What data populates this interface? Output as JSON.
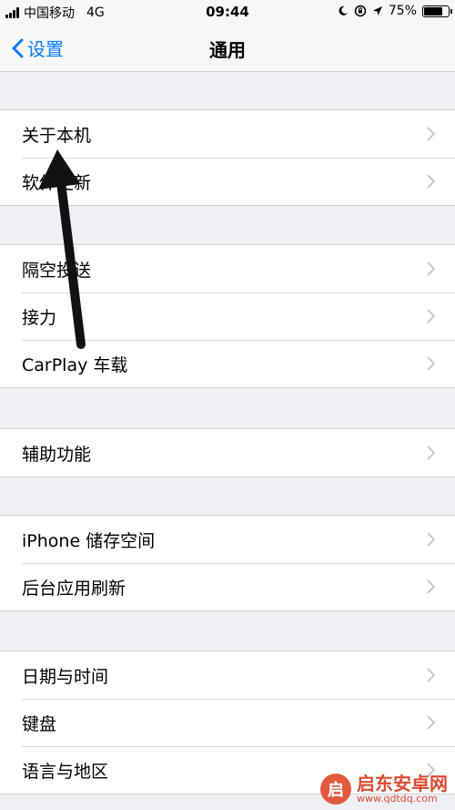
{
  "status_bar": {
    "carrier": "中国移动",
    "network": "4G",
    "time": "09:44",
    "battery": "75%",
    "battery_level": 0.75
  },
  "nav": {
    "back_label": "设置",
    "title": "通用"
  },
  "groups": [
    {
      "items": [
        "关于本机",
        "软件更新"
      ]
    },
    {
      "items": [
        "隔空投送",
        "接力",
        "CarPlay 车载"
      ]
    },
    {
      "items": [
        "辅助功能"
      ]
    },
    {
      "items": [
        "iPhone 储存空间",
        "后台应用刷新"
      ]
    },
    {
      "items": [
        "日期与时间",
        "键盘",
        "语言与地区"
      ]
    }
  ],
  "annotation": {
    "type": "arrow",
    "points_to": "关于本机"
  },
  "watermark": {
    "name": "启东安卓网",
    "url": "www.qdtdq.com"
  },
  "colors": {
    "accent": "#0a7aff",
    "background": "#efeff4",
    "chevron": "#c7c7cc"
  }
}
